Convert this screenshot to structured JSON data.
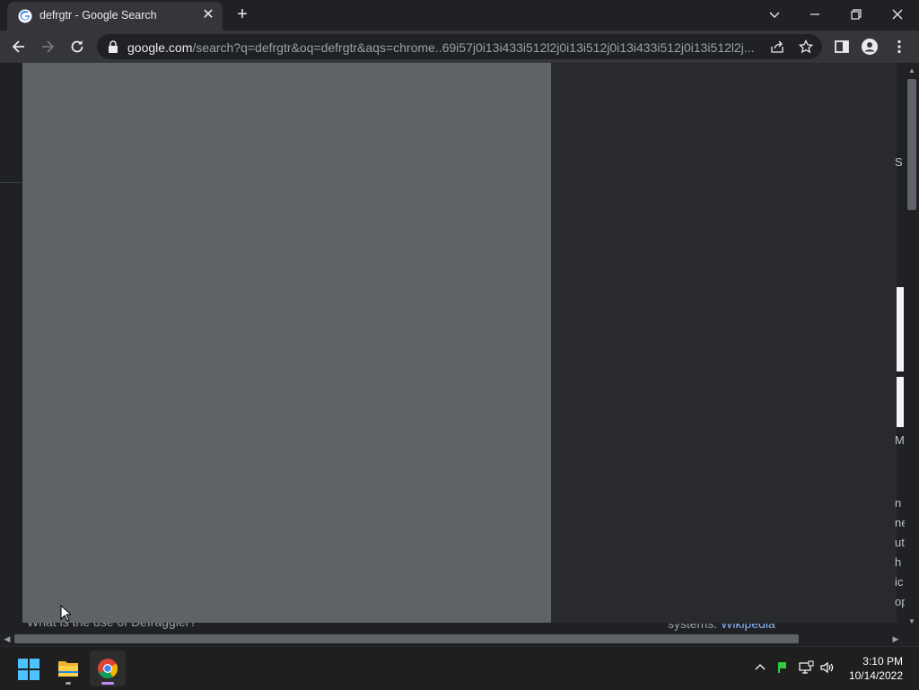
{
  "browser": {
    "tab_title": "defrgtr - Google Search",
    "url_host": "google.com",
    "url_rest": "/search?q=defrgtr&oq=defrgtr&aqs=chrome..69i57j0i13i433i512l2j0i13i512j0i13i433i512j0i13i512l2j..."
  },
  "page": {
    "left_text": "What is the use of Defraggler?",
    "right_text": "systems.",
    "right_link": "Wikipedia",
    "edge_chars_top": "S",
    "edge_chars_mid": "M",
    "edge_chars_list": [
      "n",
      "ne",
      "ut",
      "h",
      "ic",
      "op"
    ]
  },
  "taskbar": {
    "clock_time": "3:10 PM",
    "clock_date": "10/14/2022"
  },
  "colors": {
    "overlay_left": "#5f6368",
    "overlay_right": "#292a2d",
    "chrome_dark": "#202124",
    "link": "#8ab4f8"
  },
  "icons": [
    "google-favicon",
    "tab-close-icon",
    "new-tab-icon",
    "tab-search-icon",
    "minimize-icon",
    "restore-icon",
    "window-close-icon",
    "back-arrow-icon",
    "forward-arrow-icon",
    "reload-icon",
    "lock-icon",
    "share-icon",
    "bookmark-star-icon",
    "side-panel-icon",
    "profile-icon",
    "menu-dots-icon",
    "windows-start-icon",
    "file-explorer-icon",
    "chrome-icon",
    "chevron-up-icon",
    "green-flag-icon",
    "network-icon",
    "volume-icon",
    "mouse-cursor-icon"
  ]
}
